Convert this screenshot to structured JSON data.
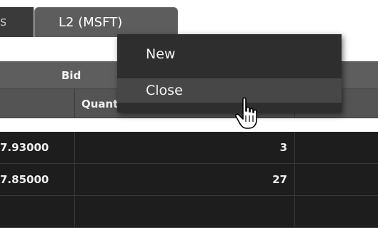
{
  "tabs": [
    {
      "label": "s"
    },
    {
      "label": "L2 (MSFT)"
    }
  ],
  "table": {
    "group_header": "Bid",
    "column_headers": [
      "Quantity"
    ],
    "rows": [
      {
        "price": "7.93000",
        "quantity": "3"
      },
      {
        "price": "7.85000",
        "quantity": "27"
      }
    ]
  },
  "context_menu": {
    "items": [
      {
        "label": "New"
      },
      {
        "label": "Close"
      }
    ]
  },
  "cursor": {
    "icon": "hand-pointer-icon"
  },
  "colors": {
    "background": "#ffffff",
    "tab_active": "#5d5d5d",
    "header": "#5e5e5e",
    "row": "#1d1d1d",
    "menu": "#2e2e2e",
    "menu_hover": "#474747"
  }
}
